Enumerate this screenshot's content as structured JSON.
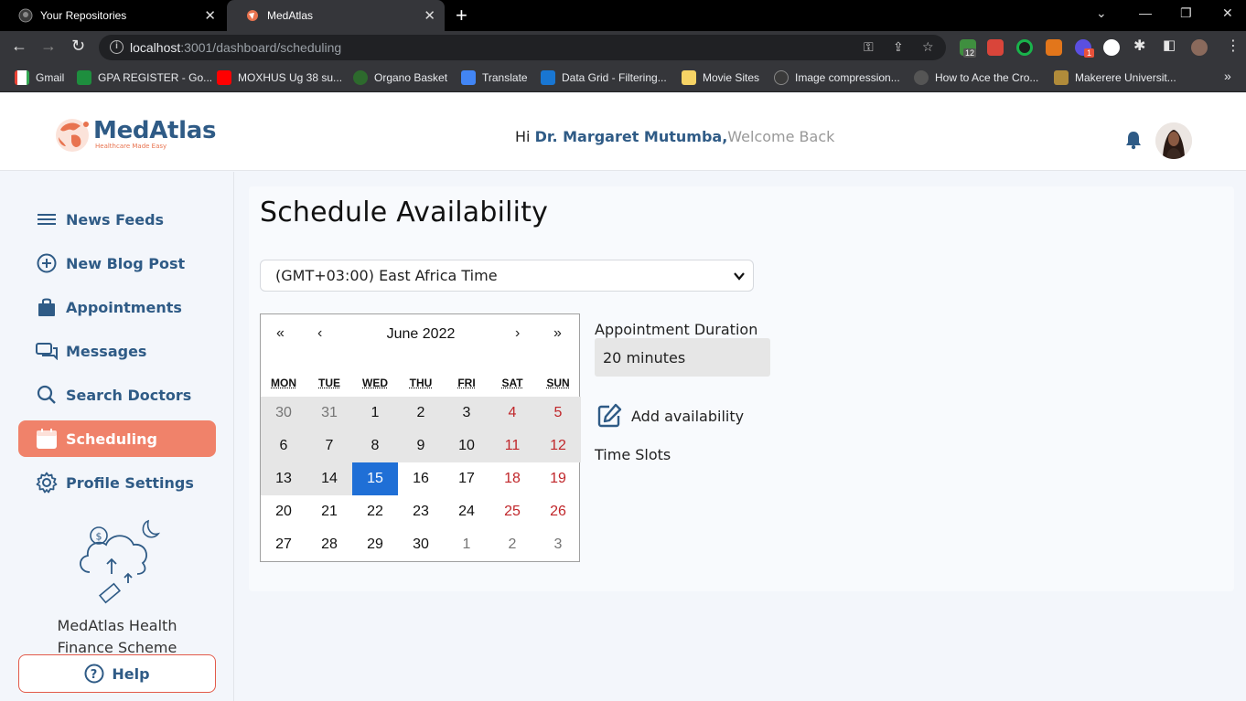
{
  "browser": {
    "tabs": [
      {
        "title": "Your Repositories",
        "active": false
      },
      {
        "title": "MedAtlas",
        "active": true
      }
    ],
    "url_host": "localhost",
    "url_rest": ":3001/dashboard/scheduling",
    "extension_badges": [
      "12",
      "1"
    ],
    "bookmarks": [
      "Gmail",
      "GPA REGISTER - Go...",
      "MOXHUS Ug 38 su...",
      "Organo Basket",
      "Translate",
      "Data Grid - Filtering...",
      "Movie Sites",
      "Image compression...",
      "How to Ace the Cro...",
      "Makerere Universit..."
    ],
    "bookmarks_more": "»"
  },
  "header": {
    "logo_name": "MedAtlas",
    "logo_tagline": "Healthcare Made Easy",
    "greeting_prefix": "Hi ",
    "doctor_name": "Dr. Margaret Mutumba,",
    "welcome": "Welcome Back"
  },
  "sidebar": {
    "items": [
      {
        "label": "News Feeds",
        "icon": "menu-icon",
        "active": false
      },
      {
        "label": "New Blog Post",
        "icon": "plus-circle-icon",
        "active": false
      },
      {
        "label": "Appointments",
        "icon": "bag-icon",
        "active": false
      },
      {
        "label": "Messages",
        "icon": "chat-icon",
        "active": false
      },
      {
        "label": "Search Doctors",
        "icon": "search-icon",
        "active": false
      },
      {
        "label": "Scheduling",
        "icon": "calendar-icon",
        "active": true
      },
      {
        "label": "Profile Settings",
        "icon": "gear-icon",
        "active": false
      }
    ],
    "promo_text": "MedAtlas Health Finance Scheme",
    "help_label": "Help"
  },
  "main": {
    "title": "Schedule Availability",
    "timezone_value": "(GMT+03:00) East Africa Time",
    "calendar": {
      "month_label": "June 2022",
      "nav": {
        "prev_year": "«",
        "prev_month": "‹",
        "next_month": "›",
        "next_year": "»"
      },
      "weekdays": [
        "MON",
        "TUE",
        "WED",
        "THU",
        "FRI",
        "SAT",
        "SUN"
      ],
      "weeks": [
        [
          "30",
          "31",
          "1",
          "2",
          "3",
          "4",
          "5"
        ],
        [
          "6",
          "7",
          "8",
          "9",
          "10",
          "11",
          "12"
        ],
        [
          "13",
          "14",
          "15",
          "16",
          "17",
          "18",
          "19"
        ],
        [
          "20",
          "21",
          "22",
          "23",
          "24",
          "25",
          "26"
        ],
        [
          "27",
          "28",
          "29",
          "30",
          "1",
          "2",
          "3"
        ]
      ],
      "selected_day": "15",
      "selected_color": "#1f6fd6",
      "weekend_color": "#c0262a"
    },
    "duration_label": "Appointment Duration",
    "duration_value": "20 minutes",
    "add_availability_label": "Add availability",
    "time_slots_label": "Time Slots"
  },
  "colors": {
    "brand_blue": "#2f5b86",
    "accent_orange": "#f0826a"
  }
}
